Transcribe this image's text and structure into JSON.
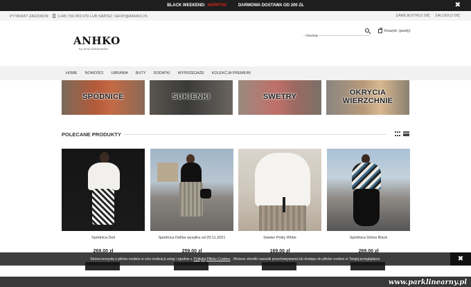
{
  "topbar": {
    "promo": "BLACK WEEKEND:",
    "code": "HAPPY30",
    "free_shipping": "DARMOWA DOSTAWA OD 200 ZŁ",
    "close": "✖"
  },
  "contact": {
    "question": "PYTANIA? ZADZWOŃ:",
    "phone_email": "(+48) 790 359 070 LUB NAPISZ: SHOP@ANHKO.PL",
    "register": "ZAREJESTRUJ SIĘ",
    "login": "ZALOGUJ SIĘ"
  },
  "header": {
    "logo_text": "ANHKO",
    "logo_signature": "by Anna Kołakowska",
    "search_placeholder": "Szukaj",
    "cart_label": "Koszyk: (pusty)"
  },
  "nav": {
    "items": [
      "HOME",
      "NOWOŚCI",
      "UBRANIA",
      "BUTY",
      "DODATKI",
      "WYPRZEDAŻE",
      "KOLEKCJA PREMIUM"
    ]
  },
  "categories": [
    {
      "label": "SPÓDNICE"
    },
    {
      "label": "SUKIENKI"
    },
    {
      "label": "SWETRY"
    },
    {
      "label": "OKRYCIA WIERZCHNIE"
    }
  ],
  "section": {
    "title": "POLECANE PRODUKTY"
  },
  "products": [
    {
      "name": "Spódnica Deli",
      "price": "269,00 zł"
    },
    {
      "name": "Spódnica Delika wysyłka od 29.11.2021",
      "price": "259,00 zł"
    },
    {
      "name": "Sweter Pinky White",
      "price": "169,00 zł"
    },
    {
      "name": "Spódnica Deliss Black",
      "price": "269,00 zł"
    }
  ],
  "cookie": {
    "text_before": "Strona korzysta z plików cookies w celu realizacji usług i zgodnie z",
    "link": "Polityką Plików Cookies",
    "text_after": ". Możesz określić warunki przechowywania lub dostępu do plików cookies w Twojej przeglądarce.",
    "close": "✖"
  },
  "watermark": "www.parklinearny.pl"
}
